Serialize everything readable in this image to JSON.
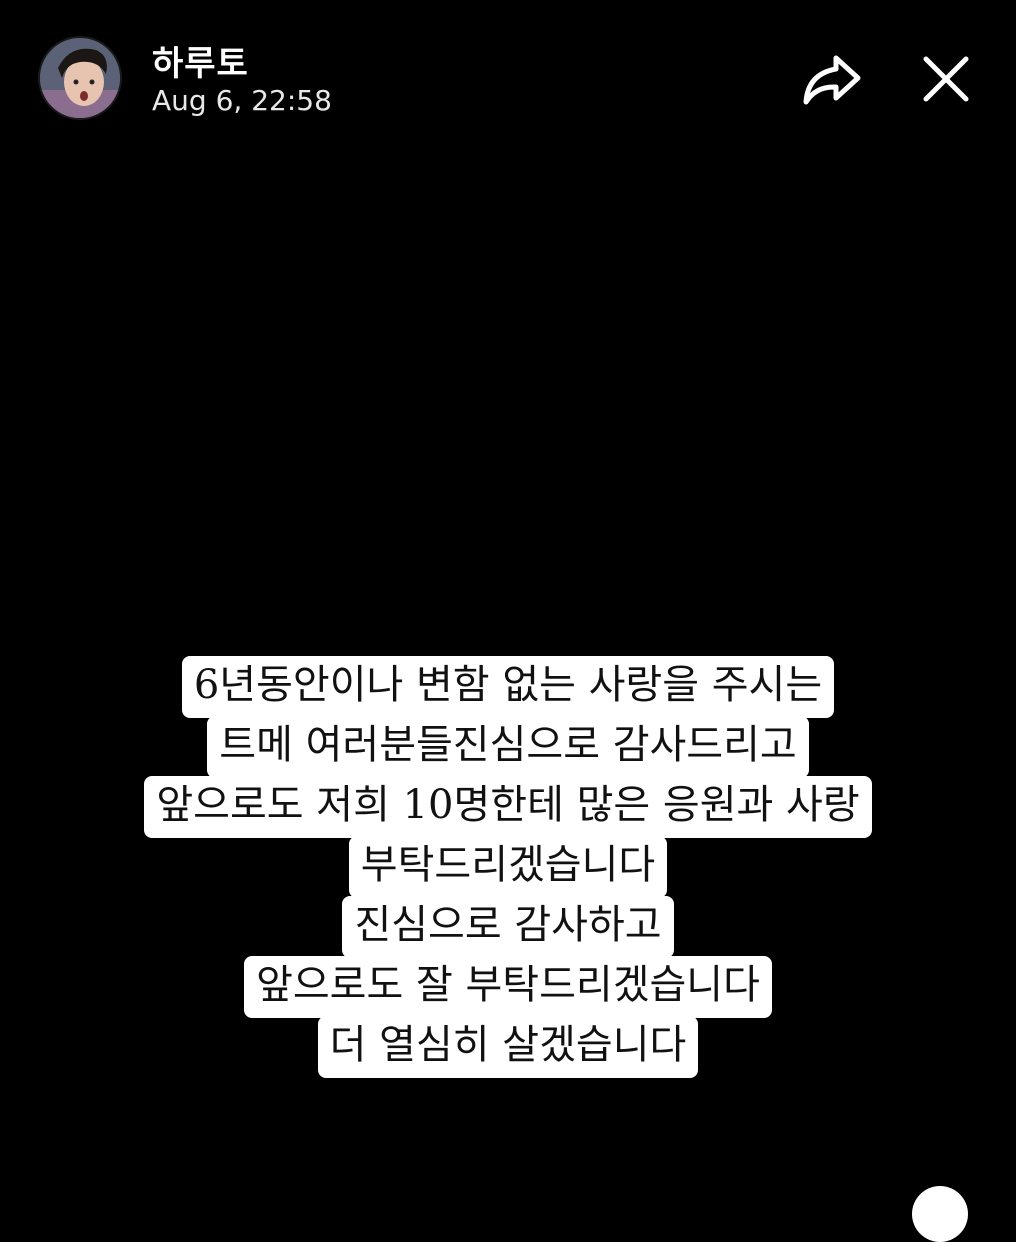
{
  "header": {
    "username": "하루토",
    "timestamp": "Aug 6, 22:58",
    "avatar_icon": "profile-photo",
    "share_icon": "share-arrow-icon",
    "close_icon": "close-icon"
  },
  "story": {
    "background_color": "#000000",
    "caption_background": "#ffffff",
    "caption_lines": [
      "6년동안이나 변함 없는 사랑을 주시는",
      "트메 여러분들진심으로 감사드리고",
      "앞으로도 저희 10명한테 많은 응원과 사랑",
      "부탁드리겠습니다",
      "진심으로 감사하고",
      "앞으로도 잘 부탁드리겠습니다",
      "더 열심히 살겠습니다"
    ]
  }
}
